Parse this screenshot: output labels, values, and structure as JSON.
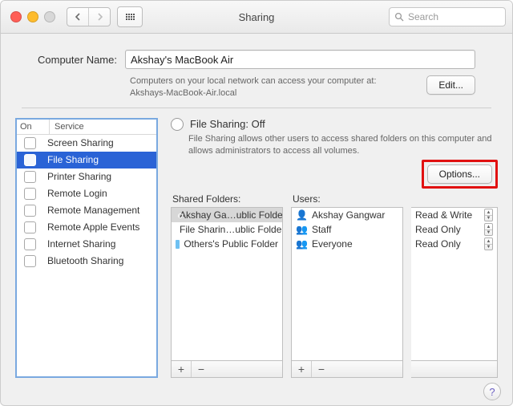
{
  "window": {
    "title": "Sharing",
    "search_placeholder": "Search"
  },
  "computer_name": {
    "label": "Computer Name:",
    "value": "Akshay's MacBook Air",
    "hint_line1": "Computers on your local network can access your computer at:",
    "hint_line2": "Akshays-MacBook-Air.local",
    "edit_label": "Edit..."
  },
  "services": {
    "col_on": "On",
    "col_service": "Service",
    "items": [
      {
        "label": "Screen Sharing",
        "checked": false,
        "selected": false
      },
      {
        "label": "File Sharing",
        "checked": false,
        "selected": true
      },
      {
        "label": "Printer Sharing",
        "checked": false,
        "selected": false
      },
      {
        "label": "Remote Login",
        "checked": false,
        "selected": false
      },
      {
        "label": "Remote Management",
        "checked": false,
        "selected": false
      },
      {
        "label": "Remote Apple Events",
        "checked": false,
        "selected": false
      },
      {
        "label": "Internet Sharing",
        "checked": false,
        "selected": false
      },
      {
        "label": "Bluetooth Sharing",
        "checked": false,
        "selected": false
      }
    ]
  },
  "detail": {
    "status_title": "File Sharing: Off",
    "status_desc": "File Sharing allows other users to access shared folders on this computer and allows administrators to access all volumes.",
    "options_label": "Options...",
    "shared_folders_label": "Shared Folders:",
    "users_label": "Users:",
    "folders": [
      {
        "label": "Akshay Ga…ublic Folder",
        "selected": true,
        "pub": true
      },
      {
        "label": "File Sharin…ublic Folder",
        "selected": false,
        "pub": false
      },
      {
        "label": "Others's Public Folder",
        "selected": false,
        "pub": false
      }
    ],
    "users": [
      {
        "icon": "single",
        "label": "Akshay Gangwar"
      },
      {
        "icon": "group",
        "label": "Staff"
      },
      {
        "icon": "group",
        "label": "Everyone"
      }
    ],
    "permissions": [
      {
        "label": "Read & Write"
      },
      {
        "label": "Read Only"
      },
      {
        "label": "Read Only"
      }
    ]
  },
  "glyphs": {
    "plus": "+",
    "minus": "−",
    "help": "?"
  }
}
